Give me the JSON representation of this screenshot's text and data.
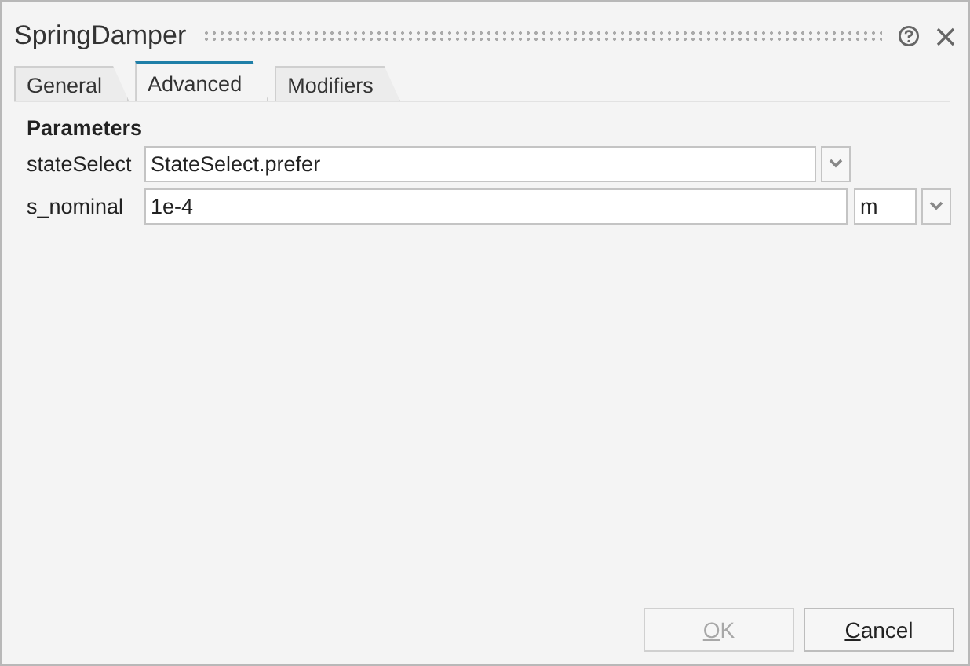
{
  "window": {
    "title": "SpringDamper"
  },
  "tabs": [
    {
      "label": "General",
      "selected": false
    },
    {
      "label": "Advanced",
      "selected": true
    },
    {
      "label": "Modifiers",
      "selected": false
    }
  ],
  "section": "Parameters",
  "params": [
    {
      "kind": "choice",
      "label": "stateSelect",
      "value": "StateSelect.prefer"
    },
    {
      "kind": "unit",
      "label": "s_nominal",
      "value": "1e-4",
      "unit": "m"
    }
  ],
  "buttons": [
    {
      "label": "OK",
      "disabled": true
    },
    {
      "label": "Cancel",
      "disabled": false
    }
  ]
}
